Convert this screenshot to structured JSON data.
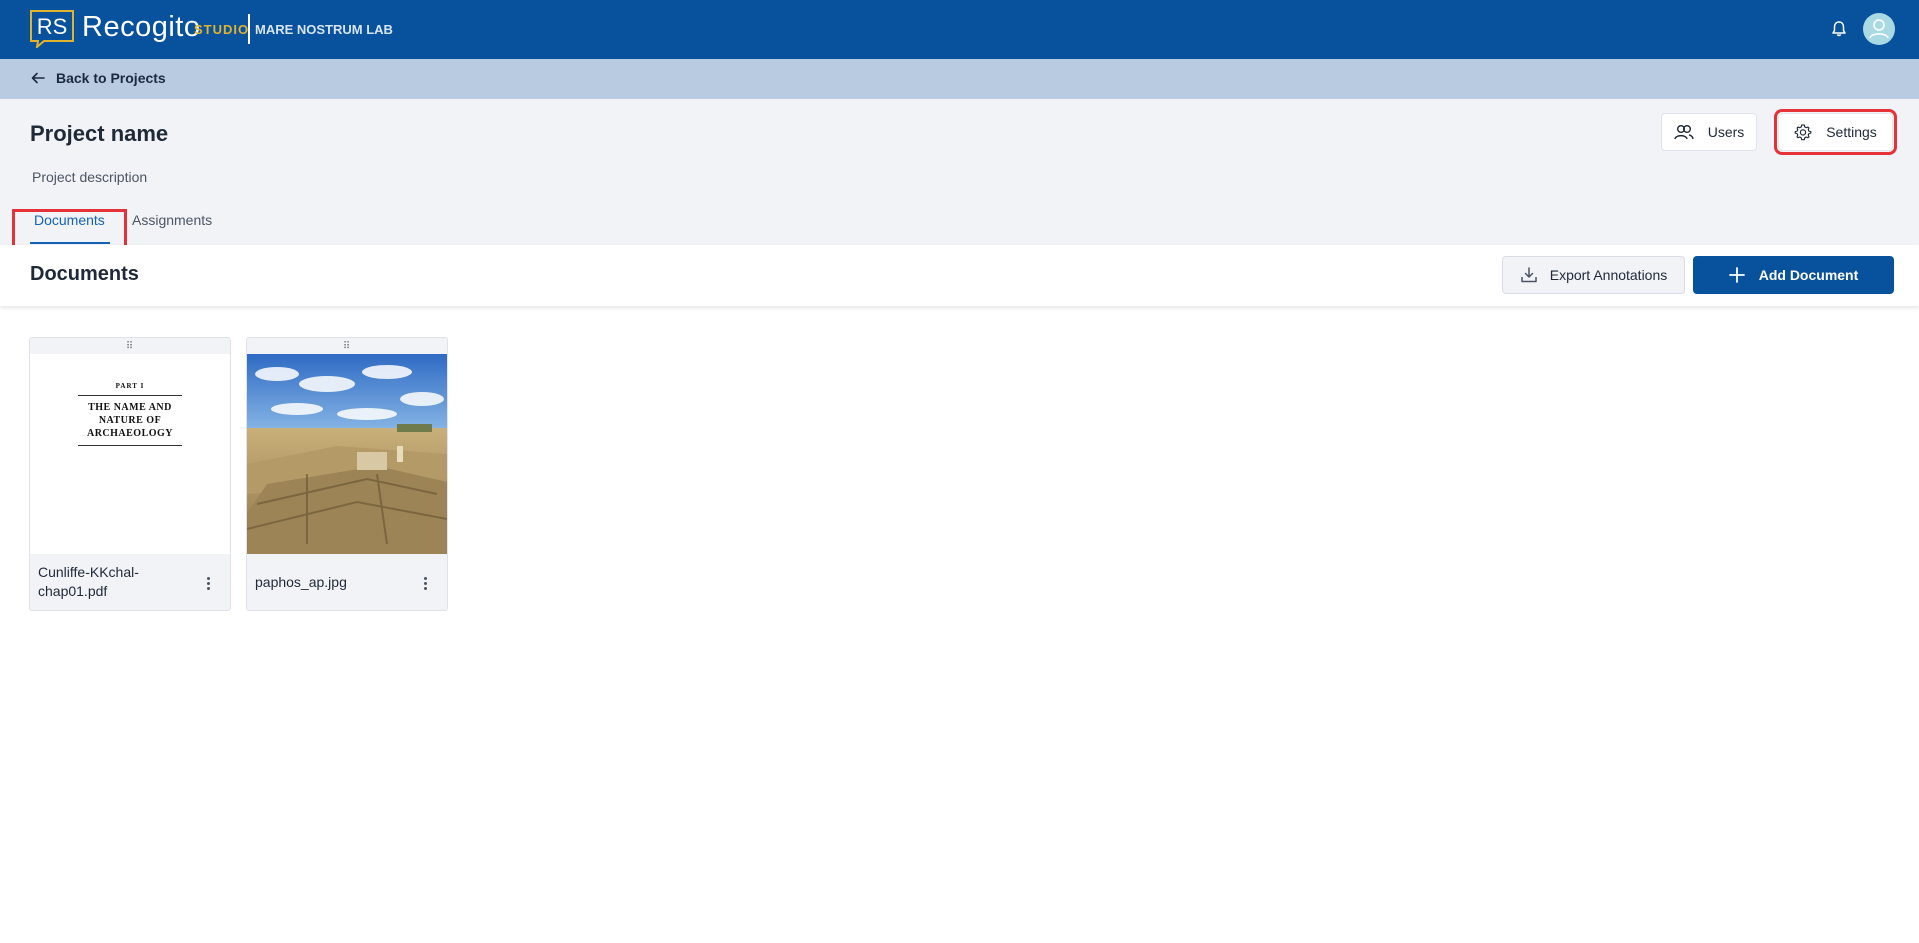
{
  "app": {
    "logo_letters": "RS",
    "name": "Recogito",
    "studio_label": "STUDIO",
    "org_name": "MARE NOSTRUM LAB",
    "icons": {
      "notifications": "bell-icon",
      "account": "user-avatar-icon"
    }
  },
  "nav": {
    "back_label": "Back to Projects"
  },
  "project": {
    "title": "Project name",
    "description": "Project description",
    "users_label": "Users",
    "settings_label": "Settings"
  },
  "tabs": [
    {
      "label": "Documents",
      "active": true
    },
    {
      "label": "Assignments",
      "active": false
    }
  ],
  "documents": {
    "heading": "Documents",
    "export_label": "Export Annotations",
    "add_label": "Add Document",
    "items": [
      {
        "name": "Cunliffe-KKchal-chap01.pdf",
        "thumb_part": "PART I",
        "thumb_title": "THE NAME AND NATURE OF ARCHAEOLOGY"
      },
      {
        "name": "paphos_ap.jpg"
      }
    ]
  },
  "colors": {
    "brand_blue": "#08519c",
    "studio_gold": "#e0b32e",
    "highlight_red": "#e53238",
    "active_tab": "#1463b8"
  }
}
